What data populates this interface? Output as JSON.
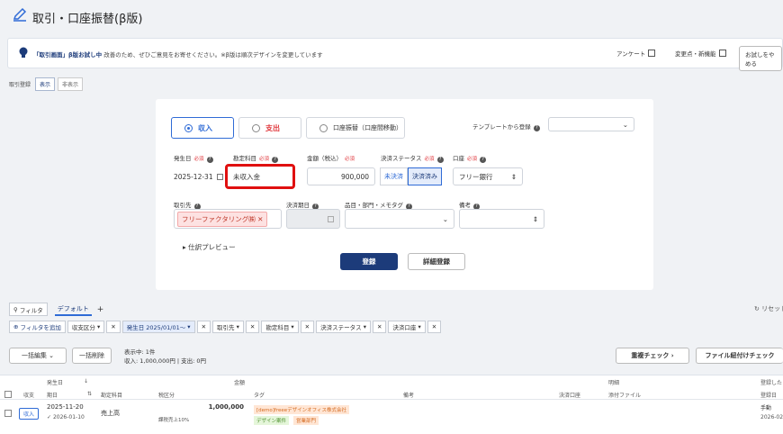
{
  "page": {
    "title": "取引・口座振替(β版)"
  },
  "banner": {
    "highlight": "「取引画面」β版お試し中",
    "message": "改善のため、ぜひご意見をお寄せください。※β版は順次デザインを変更しています",
    "survey": "アンケート",
    "changelog": "変更点・新機能",
    "quit_button": "お試しをやめる"
  },
  "toggle": {
    "label": "取引登録",
    "show": "表示",
    "hide": "非表示"
  },
  "form": {
    "tabs": [
      {
        "label": "収入",
        "active": true
      },
      {
        "label": "支出",
        "active": false
      },
      {
        "label": "口座振替（口座間移動）",
        "active": false
      }
    ],
    "template_label": "テンプレートから登録",
    "required": "必須",
    "date_label": "発生日",
    "date_value": "2025-12-31",
    "account_label": "勘定科目",
    "account_value": "未収入金",
    "amount_label": "金額（税込）",
    "amount_value": "900,000",
    "status_label": "決済ステータス",
    "status_options": [
      "未決済",
      "決済済み"
    ],
    "bank_label": "口座",
    "bank_value": "フリー銀行",
    "partner_label": "取引先",
    "partner_value": "フリーファクタリング㈱",
    "due_label": "決済期日",
    "item_label": "品目・部門・メモタグ",
    "note_label": "備考",
    "preview": "仕訳プレビュー",
    "submit": "登録",
    "detail_submit": "詳細登録"
  },
  "filters": {
    "filter_button": "フィルタ",
    "default_tab": "デフォルト",
    "add_tab": "+",
    "reset": "リセット",
    "add_filter": "フィルタを追加",
    "tags": [
      {
        "label": "収支区分",
        "hl": false
      },
      {
        "label": "発生日 2025/01/01〜",
        "hl": true
      },
      {
        "label": "取引先",
        "hl": false
      },
      {
        "label": "勘定科目",
        "hl": false
      },
      {
        "label": "決済ステータス",
        "hl": false
      },
      {
        "label": "決済口座",
        "hl": false
      }
    ]
  },
  "actions": {
    "bulk_edit": "一括編集",
    "bulk_delete": "一括削除",
    "count_text": "表示中: 1件",
    "sum_text": "収入: 1,000,000円 | 支出: 0円",
    "dup_check": "重複チェック",
    "attach_check": "ファイル紐付けチェック"
  },
  "table": {
    "headers_top": [
      "発生日",
      "金額",
      "明細",
      "登録した"
    ],
    "headers": [
      "収支",
      "期日",
      "勘定科目",
      "税区分",
      "タグ",
      "備考",
      "決済口座",
      "添付ファイル",
      "登録日"
    ],
    "rows": [
      {
        "type": "収入",
        "date": "2025-11-20",
        "due": "2026-01-10",
        "account": "売上高",
        "amount": "1,000,000",
        "tax": "課税売上10%",
        "tags": [
          "[demo]freeeデザインオフィス株式会社",
          "デザイン案件",
          "営業部門"
        ],
        "source": "手動",
        "created": "2026-02"
      }
    ]
  }
}
